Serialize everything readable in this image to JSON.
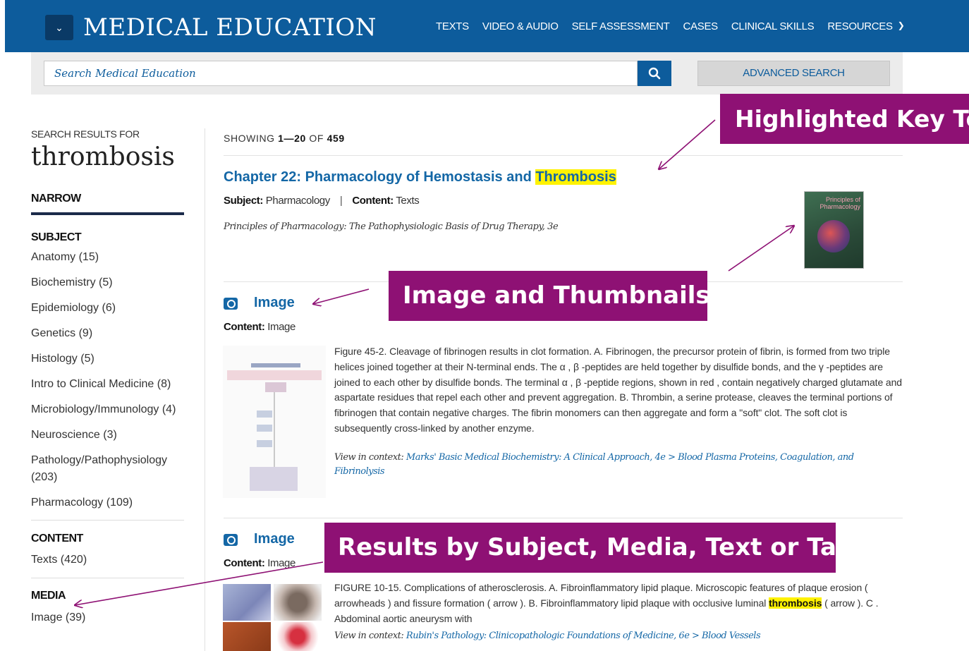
{
  "header": {
    "menu_icon": "chevron-down-icon",
    "brand": "MEDICAL EDUCATION",
    "nav": [
      "TEXTS",
      "VIDEO & AUDIO",
      "SELF ASSESSMENT",
      "CASES",
      "CLINICAL SKILLS",
      "RESOURCES"
    ]
  },
  "search": {
    "placeholder": "Search Medical Education",
    "button_icon": "search-icon",
    "advanced_label": "ADVANCED SEARCH"
  },
  "sidebar": {
    "results_for_label": "SEARCH RESULTS FOR",
    "term": "thrombosis",
    "narrow_label": "NARROW",
    "subject_label": "SUBJECT",
    "subjects": [
      "Anatomy (15)",
      "Biochemistry (5)",
      "Epidemiology (6)",
      "Genetics (9)",
      "Histology (5)",
      "Intro to Clinical Medicine (8)",
      "Microbiology/Immunology (4)",
      "Neuroscience (3)",
      "Pathology/Pathophysiology (203)",
      "Pharmacology (109)"
    ],
    "content_label": "CONTENT",
    "content_items": [
      "Texts (420)"
    ],
    "media_label": "MEDIA",
    "media_items": [
      "Image (39)"
    ]
  },
  "results": {
    "showing_prefix": "SHOWING",
    "range": "1—20",
    "of": "OF",
    "total": "459",
    "items": [
      {
        "title_prefix": "Chapter 22: Pharmacology of Hemostasis and ",
        "title_highlight": "Thrombosis",
        "subject_label": "Subject:",
        "subject": "Pharmacology",
        "content_label": "Content:",
        "content": "Texts",
        "book": "Principles of Pharmacology: The Pathophysiologic Basis of Drug Therapy, 3e",
        "cover_title": "Principles of Pharmacology"
      },
      {
        "icon": "camera-icon",
        "title": "Image",
        "content_label": "Content:",
        "content": "Image",
        "description": "Figure 45-2. Cleavage of fibrinogen results in clot formation. A. Fibrinogen, the precursor protein of fibrin, is formed from two triple helices joined together at their N-terminal ends. The α , β -peptides are held together by disulfide bonds, and the γ -peptides are joined to each other by disulfide bonds. The terminal α , β -peptide regions, shown in red , contain negatively charged glutamate and aspartate residues that repel each other and prevent aggregation. B. Thrombin, a serine protease, cleaves the terminal portions of fibrinogen that contain negative charges. The fibrin monomers can then aggregate and form a \"soft\" clot. The soft clot is subsequently cross-linked by another enzyme.",
        "context_label": "View in context: ",
        "context_link": "Marks' Basic Medical Biochemistry: A Clinical Approach, 4e > Blood Plasma Proteins, Coagulation, and Fibrinolysis"
      },
      {
        "icon": "camera-icon",
        "title": "Image",
        "content_label": "Content:",
        "content": "Image",
        "description_before": "FIGURE 10-15. Complications of atherosclerosis. A. Fibroinflammatory lipid plaque. Microscopic features of plaque erosion ( arrowheads ) and fissure formation ( arrow ). B. Fibroinflammatory lipid plaque with occlusive luminal ",
        "description_highlight": "thrombosis",
        "description_after": " ( arrow ). C . Abdominal aortic aneurysm with",
        "context_label": "View in context: ",
        "context_link": "Rubin's Pathology: Clinicopathologic Foundations of Medicine, 6e > Blood Vessels"
      }
    ]
  },
  "annotations": {
    "highlighted": "Highlighted Key Terms",
    "images": "Image and Thumbnails",
    "results_by": "Results by Subject, Media, Text or Tags",
    "color": "#8e1174"
  }
}
